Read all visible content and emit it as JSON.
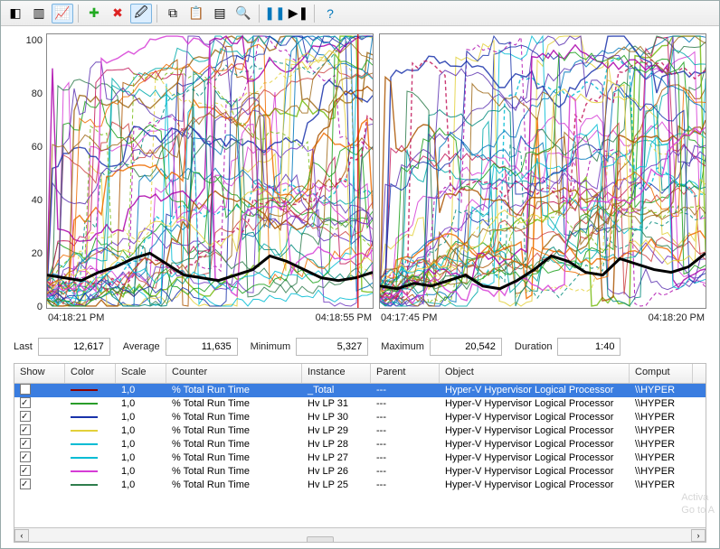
{
  "toolbar": {
    "buttons": [
      {
        "name": "view-tree-icon",
        "glyph": "◧"
      },
      {
        "name": "view-report-icon",
        "glyph": "▥"
      },
      {
        "name": "view-graph-icon",
        "glyph": "📈",
        "active": true
      },
      {
        "name": "sep"
      },
      {
        "name": "add-icon",
        "glyph": "✚",
        "color": "#2a2"
      },
      {
        "name": "delete-icon",
        "glyph": "✖",
        "color": "#d22"
      },
      {
        "name": "highlight-icon",
        "glyph": "🖉",
        "active": true
      },
      {
        "name": "sep"
      },
      {
        "name": "copy-icon",
        "glyph": "⧉"
      },
      {
        "name": "paste-icon",
        "glyph": "📋"
      },
      {
        "name": "properties-icon",
        "glyph": "▤"
      },
      {
        "name": "zoom-icon",
        "glyph": "🔍"
      },
      {
        "name": "sep"
      },
      {
        "name": "freeze-icon",
        "glyph": "❚❚",
        "color": "#07b"
      },
      {
        "name": "update-icon",
        "glyph": "▶❚"
      },
      {
        "name": "sep"
      },
      {
        "name": "help-icon",
        "glyph": "?",
        "color": "#07b"
      }
    ]
  },
  "chart_data": {
    "type": "line",
    "ylim": [
      0,
      100
    ],
    "yticks": [
      0,
      20,
      40,
      60,
      80,
      100
    ],
    "panels": [
      {
        "x_start": "04:18:21 PM",
        "x_end": "04:18:55 PM"
      },
      {
        "x_start": "04:17:45 PM",
        "x_end": "04:18:20 PM"
      }
    ],
    "series_colors": [
      "#8b0000",
      "#2a9d2a",
      "#1a33aa",
      "#e3d03a",
      "#00bcd4",
      "#d63cd6",
      "#2f7d4d",
      "#00a7c2"
    ],
    "highlight_series": {
      "name": "_Total",
      "color": "#000",
      "thick": true,
      "avg_baseline_panelA": [
        12,
        11,
        10,
        13,
        15,
        18,
        20,
        16,
        12,
        11,
        10,
        12,
        14,
        19,
        17,
        14,
        11,
        10,
        11,
        13
      ],
      "avg_baseline_panelB": [
        8,
        7,
        9,
        8,
        10,
        12,
        8,
        7,
        10,
        14,
        19,
        17,
        13,
        12,
        18,
        16,
        14,
        13,
        15,
        20
      ]
    }
  },
  "stats": {
    "last_label": "Last",
    "last": "12,617",
    "avg_label": "Average",
    "avg": "11,635",
    "min_label": "Minimum",
    "min": "5,327",
    "max_label": "Maximum",
    "max": "20,542",
    "dur_label": "Duration",
    "dur": "1:40"
  },
  "grid": {
    "headers": {
      "show": "Show",
      "color": "Color",
      "scale": "Scale",
      "counter": "Counter",
      "instance": "Instance",
      "parent": "Parent",
      "object": "Object",
      "computer": "Comput"
    },
    "rows": [
      {
        "checked": true,
        "color": "#8b0000",
        "scale": "1,0",
        "counter": "% Total Run Time",
        "instance": "_Total",
        "parent": "---",
        "object": "Hyper-V Hypervisor Logical Processor",
        "computer": "\\\\HYPER",
        "selected": true
      },
      {
        "checked": true,
        "color": "#2a9d2a",
        "scale": "1,0",
        "counter": "% Total Run Time",
        "instance": "Hv LP 31",
        "parent": "---",
        "object": "Hyper-V Hypervisor Logical Processor",
        "computer": "\\\\HYPER"
      },
      {
        "checked": true,
        "color": "#1a33aa",
        "scale": "1,0",
        "counter": "% Total Run Time",
        "instance": "Hv LP 30",
        "parent": "---",
        "object": "Hyper-V Hypervisor Logical Processor",
        "computer": "\\\\HYPER"
      },
      {
        "checked": true,
        "color": "#e3d03a",
        "scale": "1,0",
        "counter": "% Total Run Time",
        "instance": "Hv LP 29",
        "parent": "---",
        "object": "Hyper-V Hypervisor Logical Processor",
        "computer": "\\\\HYPER"
      },
      {
        "checked": true,
        "color": "#00bcd4",
        "scale": "1,0",
        "counter": "% Total Run Time",
        "instance": "Hv LP 28",
        "parent": "---",
        "object": "Hyper-V Hypervisor Logical Processor",
        "computer": "\\\\HYPER"
      },
      {
        "checked": true,
        "color": "#00bcd4",
        "scale": "1,0",
        "counter": "% Total Run Time",
        "instance": "Hv LP 27",
        "parent": "---",
        "object": "Hyper-V Hypervisor Logical Processor",
        "computer": "\\\\HYPER"
      },
      {
        "checked": true,
        "color": "#d63cd6",
        "scale": "1,0",
        "counter": "% Total Run Time",
        "instance": "Hv LP 26",
        "parent": "---",
        "object": "Hyper-V Hypervisor Logical Processor",
        "computer": "\\\\HYPER"
      },
      {
        "checked": true,
        "color": "#2f7d4d",
        "scale": "1,0",
        "counter": "% Total Run Time",
        "instance": "Hv LP 25",
        "parent": "---",
        "object": "Hyper-V Hypervisor Logical Processor",
        "computer": "\\\\HYPER"
      }
    ]
  },
  "watermark": {
    "line1": "Activa",
    "line2": "Go to A"
  }
}
